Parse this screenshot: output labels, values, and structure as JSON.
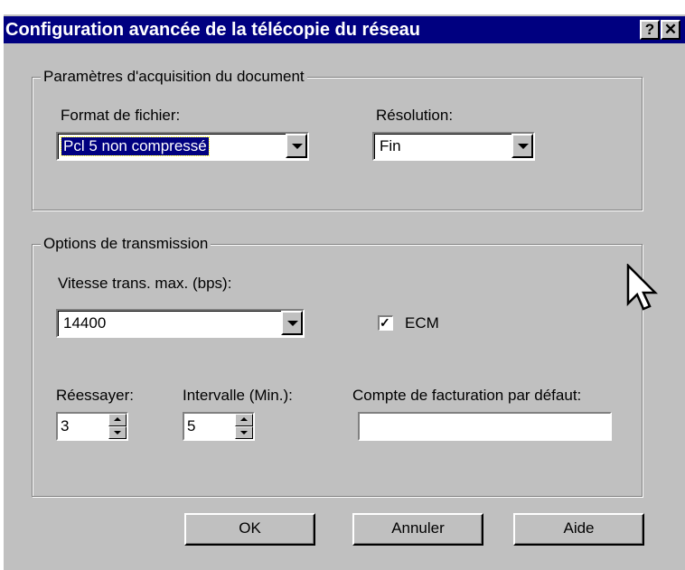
{
  "window": {
    "title": "Configuration avancée de la télécopie du réseau",
    "help_button": "?",
    "close_button": "✕"
  },
  "acquisition": {
    "legend": "Paramètres d'acquisition du document",
    "file_format_label": "Format de fichier:",
    "file_format_value": "Pcl 5 non compressé",
    "resolution_label": "Résolution:",
    "resolution_value": "Fin"
  },
  "transmission": {
    "legend": "Options de transmission",
    "max_speed_label": "Vitesse trans. max. (bps):",
    "max_speed_value": "14400",
    "ecm_label": "ECM",
    "ecm_checked": true,
    "retry_label": "Réessayer:",
    "retry_value": "3",
    "interval_label": "Intervalle (Min.):",
    "interval_value": "5",
    "billing_label": "Compte de facturation par défaut:",
    "billing_value": ""
  },
  "buttons": {
    "ok": "OK",
    "cancel": "Annuler",
    "help": "Aide"
  }
}
